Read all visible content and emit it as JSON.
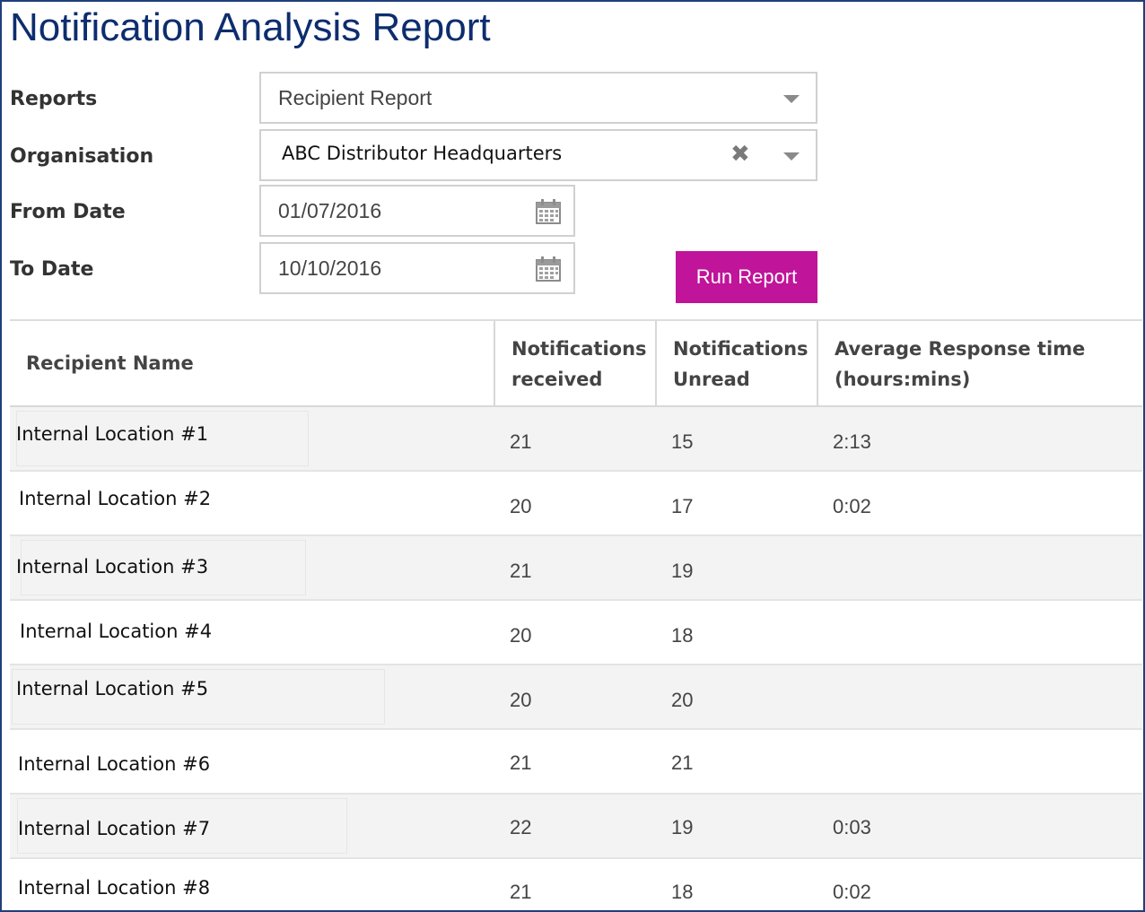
{
  "page": {
    "title": "Notification Analysis Report"
  },
  "form": {
    "reports": {
      "label": "Reports",
      "value": "Recipient Report"
    },
    "organisation": {
      "label": "Organisation",
      "value": "ABC Distributor Headquarters"
    },
    "from_date": {
      "label": "From Date",
      "value": "01/07/2016"
    },
    "to_date": {
      "label": "To Date",
      "value": "10/10/2016"
    },
    "run_label": "Run Report"
  },
  "icons": {
    "dropdown": "chevron-down-icon",
    "clear": "close-icon",
    "calendar": "calendar-icon"
  },
  "colors": {
    "title": "#0d2d6e",
    "button": "#c0149a",
    "row_alt": "#f3f3f3"
  },
  "table": {
    "headers": [
      [
        "Recipient Name"
      ],
      [
        "Notifications",
        "received"
      ],
      [
        "Notifications",
        "Unread"
      ],
      [
        "Average Response time",
        "(hours:mins)"
      ]
    ],
    "rows": [
      {
        "name": "Internal Location #1",
        "received": "21",
        "unread": "15",
        "avg": "2:13"
      },
      {
        "name": "Internal Location #2",
        "received": "20",
        "unread": "17",
        "avg": "0:02"
      },
      {
        "name": "Internal Location #3",
        "received": "21",
        "unread": "19",
        "avg": ""
      },
      {
        "name": "Internal Location #4",
        "received": "20",
        "unread": "18",
        "avg": ""
      },
      {
        "name": "Internal Location #5",
        "received": "20",
        "unread": "20",
        "avg": ""
      },
      {
        "name": "Internal Location #6",
        "received": "21",
        "unread": "21",
        "avg": ""
      },
      {
        "name": "Internal Location #7",
        "received": "22",
        "unread": "19",
        "avg": "0:03"
      },
      {
        "name": "Internal Location #8",
        "received": "21",
        "unread": "18",
        "avg": "0:02"
      }
    ]
  }
}
